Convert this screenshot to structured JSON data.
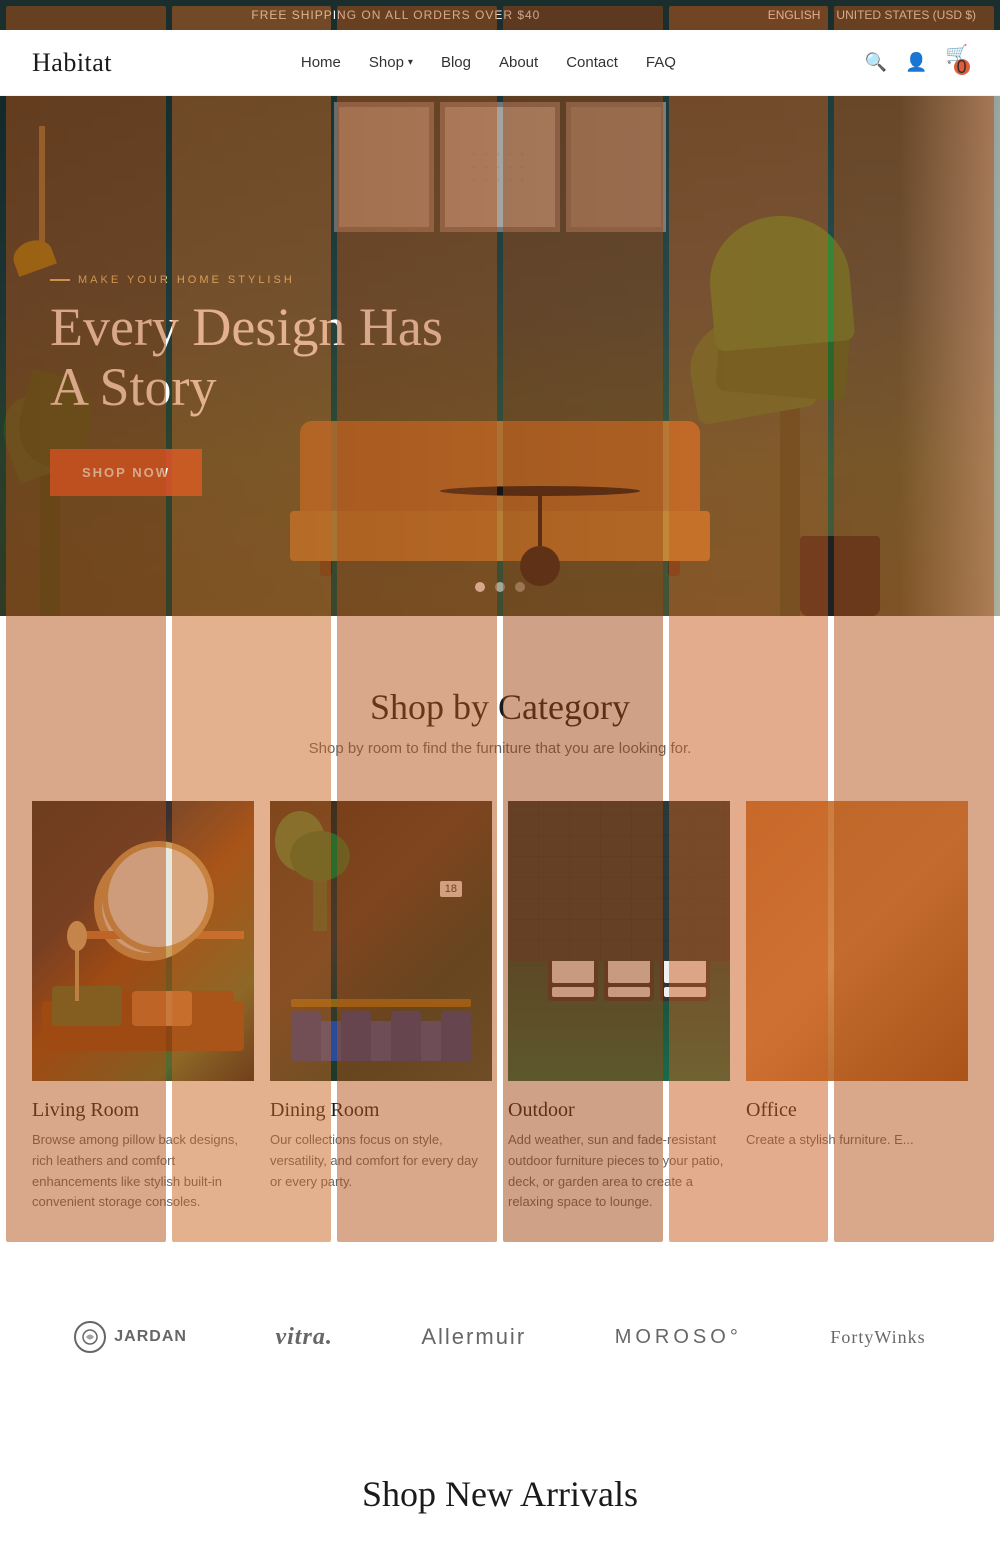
{
  "topbar": {
    "shipping_message": "FREE SHIPPING ON ALL ORDERS OVER $40",
    "language": "ENGLISH",
    "currency": "UNITED STATES (USD $)"
  },
  "header": {
    "logo": "Habitat",
    "nav": [
      {
        "label": "Home",
        "hasDropdown": false
      },
      {
        "label": "Shop",
        "hasDropdown": true
      },
      {
        "label": "Blog",
        "hasDropdown": false
      },
      {
        "label": "About",
        "hasDropdown": false
      },
      {
        "label": "Contact",
        "hasDropdown": false
      },
      {
        "label": "FAQ",
        "hasDropdown": false
      }
    ],
    "cart_count": "0"
  },
  "hero": {
    "eyebrow": "MAKE YOUR HOME STYLISH",
    "title": "Every Design Has A Story",
    "cta_label": "SHOP NOW",
    "slides": 3,
    "active_slide": 0
  },
  "category_section": {
    "title": "Shop by Category",
    "subtitle": "Shop by room to find the furniture that you are looking for.",
    "categories": [
      {
        "name": "Living Room",
        "desc": "Browse among pillow back designs, rich leathers and comfort enhancements like stylish built-in convenient storage consoles.",
        "type": "living"
      },
      {
        "name": "Dining Room",
        "desc": "Our collections focus on style, versatility, and comfort for every day or every party.",
        "type": "dining"
      },
      {
        "name": "Outdoor",
        "desc": "Add weather, sun and fade-resistant outdoor furniture pieces to your patio, deck, or garden area to create a relaxing space to lounge.",
        "type": "outdoor"
      },
      {
        "name": "Office",
        "desc": "Create a stylish furniture. E...",
        "type": "office"
      }
    ]
  },
  "brands": {
    "items": [
      {
        "name": "JARDAN",
        "style": "jardan"
      },
      {
        "name": "vitra.",
        "style": "vitra"
      },
      {
        "name": "Allermuir",
        "style": "allermuir"
      },
      {
        "name": "MOROSO°",
        "style": "moroso"
      },
      {
        "name": "FortyWinks",
        "style": "fortywinks"
      }
    ]
  },
  "new_arrivals": {
    "title": "Shop New Arrivals"
  }
}
